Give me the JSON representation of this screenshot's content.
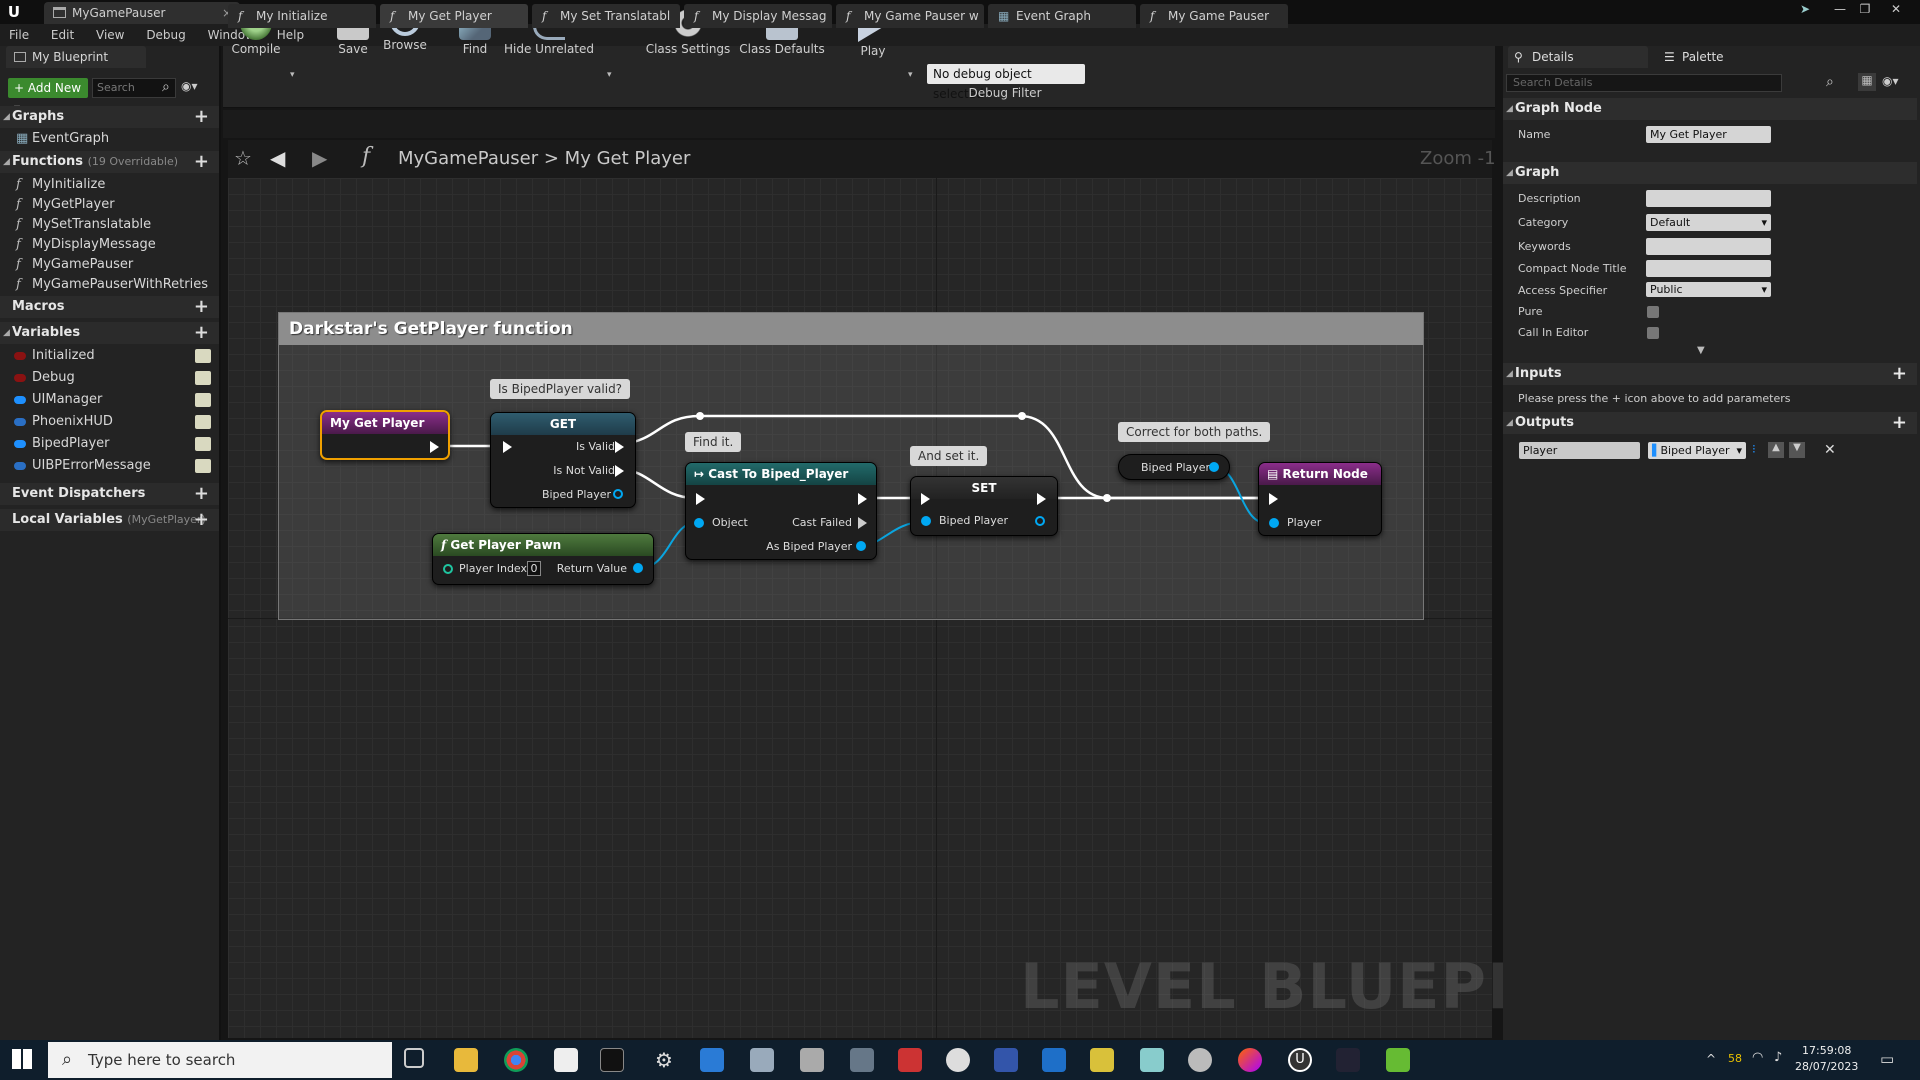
{
  "window": {
    "title": "MyGamePauser",
    "logo": "U"
  },
  "menu": [
    "File",
    "Edit",
    "View",
    "Debug",
    "Window",
    "Help"
  ],
  "left_panel": {
    "tab": "My Blueprint",
    "add_new": "Add New",
    "search_placeholder": "Search",
    "graphs_label": "Graphs",
    "graphs": [
      "EventGraph"
    ],
    "functions_label": "Functions",
    "functions_sub": "(19 Overridable)",
    "functions": [
      "MyInitialize",
      "MyGetPlayer",
      "MySetTranslatable",
      "MyDisplayMessage",
      "MyGamePauser",
      "MyGamePauserWithRetries"
    ],
    "macros_label": "Macros",
    "variables_label": "Variables",
    "variables": [
      {
        "name": "Initialized",
        "color": "#8a1212"
      },
      {
        "name": "Debug",
        "color": "#8a1212"
      },
      {
        "name": "UIManager",
        "color": "#1e90ff"
      },
      {
        "name": "PhoenixHUD",
        "color": "#2a6fc4"
      },
      {
        "name": "BipedPlayer",
        "color": "#1e90ff"
      },
      {
        "name": "UIBPErrorMessage",
        "color": "#2a6fc4"
      }
    ],
    "event_dispatchers_label": "Event Dispatchers",
    "local_variables_label": "Local Variables",
    "local_variables_sub": "(MyGetPlayer)"
  },
  "toolbar": {
    "compile": "Compile",
    "save": "Save",
    "browse": "Browse",
    "find": "Find",
    "hide_unrelated": "Hide Unrelated",
    "class_settings": "Class Settings",
    "class_defaults": "Class Defaults",
    "play": "Play",
    "debug_object": "No debug object selected",
    "debug_filter": "Debug Filter"
  },
  "graph_tabs": [
    "My Initialize",
    "My Get Player",
    "My Set Translatabl",
    "My Display Messag",
    "My Game Pauser w",
    "Event Graph",
    "My Game Pauser"
  ],
  "breadcrumb": {
    "parent": "MyGamePauser",
    "sep": ">",
    "current": "My Get Player",
    "zoom": "Zoom -1"
  },
  "graph": {
    "comment_title": "Darkstar's GetPlayer function",
    "watermark": "LEVEL BLUEPRINT",
    "entry_node": "My Get Player",
    "get_node": {
      "title": "GET",
      "is_valid": "Is Valid",
      "is_not_valid": "Is Not Valid",
      "biped": "Biped Player"
    },
    "bubble_valid": "Is BipedPlayer valid?",
    "bubble_find": "Find it.",
    "bubble_set": "And set it.",
    "bubble_correct": "Correct for both paths.",
    "cast_node": {
      "title": "Cast To Biped_Player",
      "object": "Object",
      "cast_failed": "Cast Failed",
      "as_biped": "As Biped Player"
    },
    "pawn_node": {
      "title": "Get Player Pawn",
      "player_index": "Player Index",
      "index_value": "0",
      "return_value": "Return Value"
    },
    "set_node": {
      "title": "SET",
      "biped": "Biped Player"
    },
    "biped_var_node": "Biped Player",
    "return_node": {
      "title": "Return Node",
      "player": "Player"
    }
  },
  "details": {
    "tab_details": "Details",
    "tab_palette": "Palette",
    "search_placeholder": "Search Details",
    "graph_node_label": "Graph Node",
    "name_label": "Name",
    "name_value": "My Get Player",
    "graph_label": "Graph",
    "description_label": "Description",
    "category_label": "Category",
    "category_value": "Default",
    "keywords_label": "Keywords",
    "compact_label": "Compact Node Title",
    "access_label": "Access Specifier",
    "access_value": "Public",
    "pure_label": "Pure",
    "call_in_editor_label": "Call In Editor",
    "inputs_label": "Inputs",
    "inputs_hint": "Please press the + icon above to add parameters",
    "outputs_label": "Outputs",
    "output_name": "Player",
    "output_type": "Biped Player"
  },
  "taskbar": {
    "search_placeholder": "Type here to search",
    "battery": "58",
    "time": "17:59:08",
    "date": "28/07/2023"
  }
}
